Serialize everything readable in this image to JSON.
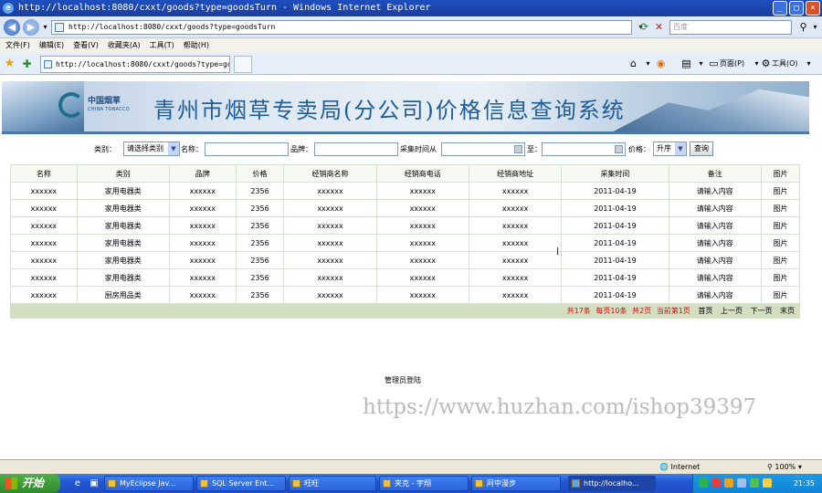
{
  "window": {
    "title": "http://localhost:8080/cxxt/goods?type=goodsTurn - Windows Internet Explorer",
    "address": "http://localhost:8080/cxxt/goods?type=goodsTurn",
    "search_placeholder": "百度",
    "tab_title": "http://localhost:8080/cxxt/goods?type=goo...",
    "page_menu": "页面(P)",
    "tools_menu": "工具(O)"
  },
  "menu": [
    "文件(F)",
    "编辑(E)",
    "查看(V)",
    "收藏夹(A)",
    "工具(T)",
    "帮助(H)"
  ],
  "banner": {
    "logo_cn": "中国烟草",
    "logo_en": "CHINA TOBACCO",
    "title": "青州市烟草专卖局(分公司)价格信息查询系统"
  },
  "form": {
    "category_label": "类别：",
    "category_value": "请选择类别",
    "name_label": "名称：",
    "brand_label": "品牌：",
    "time_from_label": "采集时间从",
    "time_to_label": "至：",
    "price_label": "价格：",
    "price_order": "升序",
    "search_button": "查询"
  },
  "table": {
    "headers": [
      "名称",
      "类别",
      "品牌",
      "价格",
      "经销商名称",
      "经销商电话",
      "经销商地址",
      "采集时间",
      "备注",
      "图片"
    ],
    "rows": [
      [
        "xxxxxx",
        "家用电器类",
        "xxxxxx",
        "2356",
        "xxxxxx",
        "xxxxxx",
        "xxxxxx",
        "2011-04-19",
        "请输入内容",
        "图片"
      ],
      [
        "xxxxxx",
        "家用电器类",
        "xxxxxx",
        "2356",
        "xxxxxx",
        "xxxxxx",
        "xxxxxx",
        "2011-04-19",
        "请输入内容",
        "图片"
      ],
      [
        "xxxxxx",
        "家用电器类",
        "xxxxxx",
        "2356",
        "xxxxxx",
        "xxxxxx",
        "xxxxxx",
        "2011-04-19",
        "请输入内容",
        "图片"
      ],
      [
        "xxxxxx",
        "家用电器类",
        "xxxxxx",
        "2356",
        "xxxxxx",
        "xxxxxx",
        "xxxxxx",
        "2011-04-19",
        "请输入内容",
        "图片"
      ],
      [
        "xxxxxx",
        "家用电器类",
        "xxxxxx",
        "2356",
        "xxxxxx",
        "xxxxxx",
        "xxxxxx",
        "2011-04-19",
        "请输入内容",
        "图片"
      ],
      [
        "xxxxxx",
        "家用电器类",
        "xxxxxx",
        "2356",
        "xxxxxx",
        "xxxxxx",
        "xxxxxx",
        "2011-04-19",
        "请输入内容",
        "图片"
      ],
      [
        "xxxxxx",
        "厨房用品类",
        "xxxxxx",
        "2356",
        "xxxxxx",
        "xxxxxx",
        "xxxxxx",
        "2011-04-19",
        "请输入内容",
        "图片"
      ]
    ]
  },
  "pagination": {
    "total": "共17条",
    "per_page": "每页10条",
    "pages": "共2页",
    "current": "当前第1页",
    "first": "首页",
    "prev": "上一页",
    "next": "下一页",
    "last": "末页"
  },
  "admin_login": "管理员登陆",
  "watermark": "https://www.huzhan.com/ishop39397",
  "status": {
    "zone": "Internet",
    "zoom": "100%"
  },
  "taskbar": {
    "start": "开始",
    "tasks": [
      "MyEclipse Jav...",
      "SQL Server Ent...",
      "旺旺",
      "夹克 - 宇翔",
      "阿中漫步",
      "http://localho..."
    ],
    "clock": "21:35"
  },
  "colors": {
    "title_bar": "#1e4fbf",
    "banner_title": "#1e5d9a",
    "pagination_red": "#d01010",
    "footer_bar": "#d4dfc2",
    "taskbar": "#2458d3",
    "start_button": "#3a9a36"
  }
}
